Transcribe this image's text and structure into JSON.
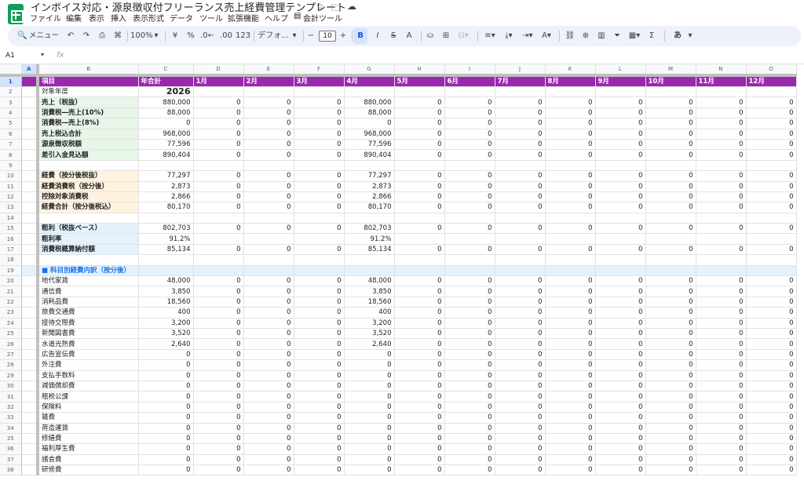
{
  "app": {
    "title": "インボイス対応・源泉徴収付フリーランス売上経費管理テンプレート",
    "title_icons": [
      "star-icon",
      "folder-move-icon",
      "cloud-status-icon"
    ]
  },
  "menu": [
    "ファイル",
    "編集",
    "表示",
    "挿入",
    "表示形式",
    "データ",
    "ツール",
    "拡張機能",
    "ヘルプ",
    "会計ツール"
  ],
  "toolbar": {
    "search_label": "メニュー",
    "zoom": "100%",
    "currency": "¥",
    "percent": "%",
    "dec_decrease": ".0←",
    "dec_increase": ".00",
    "more_formats": "123",
    "font": "デフォ...",
    "font_size": "10",
    "bold": "B",
    "italic": "I",
    "strike": "S",
    "text_color": "A",
    "input_tool": "あ"
  },
  "formula_bar": {
    "cell_ref": "A1",
    "fx": "fx",
    "formula": ""
  },
  "columns": [
    "A",
    "B",
    "C",
    "D",
    "E",
    "F",
    "G",
    "H",
    "I",
    "J",
    "K",
    "L",
    "M",
    "N",
    "O"
  ],
  "header_row": [
    "",
    "項目",
    "年合計",
    "1月",
    "2月",
    "3月",
    "4月",
    "5月",
    "6月",
    "7月",
    "8月",
    "9月",
    "10月",
    "11月",
    "12月"
  ],
  "rows": [
    {
      "n": "2",
      "style": "plain",
      "label": "対象年度",
      "total": "2026",
      "months": [
        "",
        "",
        "",
        "",
        "",
        "",
        "",
        "",
        "",
        "",
        "",
        ""
      ]
    },
    {
      "n": "3",
      "style": "green",
      "label": "売上（税抜）",
      "total": "880,000",
      "months": [
        "0",
        "0",
        "0",
        "880,000",
        "0",
        "0",
        "0",
        "0",
        "0",
        "0",
        "0",
        "0"
      ]
    },
    {
      "n": "4",
      "style": "green",
      "label": "消費税―売上(10%)",
      "total": "88,000",
      "months": [
        "0",
        "0",
        "0",
        "88,000",
        "0",
        "0",
        "0",
        "0",
        "0",
        "0",
        "0",
        "0"
      ]
    },
    {
      "n": "5",
      "style": "green",
      "label": "消費税―売上(8%)",
      "total": "0",
      "months": [
        "0",
        "0",
        "0",
        "0",
        "0",
        "0",
        "0",
        "0",
        "0",
        "0",
        "0",
        "0"
      ]
    },
    {
      "n": "6",
      "style": "green",
      "label": "売上税込合計",
      "total": "968,000",
      "months": [
        "0",
        "0",
        "0",
        "968,000",
        "0",
        "0",
        "0",
        "0",
        "0",
        "0",
        "0",
        "0"
      ]
    },
    {
      "n": "7",
      "style": "green",
      "label": "源泉徴収税額",
      "total": "77,596",
      "months": [
        "0",
        "0",
        "0",
        "77,596",
        "0",
        "0",
        "0",
        "0",
        "0",
        "0",
        "0",
        "0"
      ]
    },
    {
      "n": "8",
      "style": "green",
      "label": "差引入金見込額",
      "total": "890,404",
      "months": [
        "0",
        "0",
        "0",
        "890,404",
        "0",
        "0",
        "0",
        "0",
        "0",
        "0",
        "0",
        "0"
      ]
    },
    {
      "n": "9",
      "style": "empty",
      "label": "",
      "total": "",
      "months": [
        "",
        "",
        "",
        "",
        "",
        "",
        "",
        "",
        "",
        "",
        "",
        ""
      ]
    },
    {
      "n": "10",
      "style": "orange",
      "label": "経費（按分後税抜）",
      "total": "77,297",
      "months": [
        "0",
        "0",
        "0",
        "77,297",
        "0",
        "0",
        "0",
        "0",
        "0",
        "0",
        "0",
        "0"
      ]
    },
    {
      "n": "11",
      "style": "orange",
      "label": "経費消費税（按分後）",
      "total": "2,873",
      "months": [
        "0",
        "0",
        "0",
        "2,873",
        "0",
        "0",
        "0",
        "0",
        "0",
        "0",
        "0",
        "0"
      ]
    },
    {
      "n": "12",
      "style": "orange",
      "label": "控除対象消費税",
      "total": "2,866",
      "months": [
        "0",
        "0",
        "0",
        "2,866",
        "0",
        "0",
        "0",
        "0",
        "0",
        "0",
        "0",
        "0"
      ]
    },
    {
      "n": "13",
      "style": "orange",
      "label": "経費合計（按分後税込）",
      "total": "80,170",
      "months": [
        "0",
        "0",
        "0",
        "80,170",
        "0",
        "0",
        "0",
        "0",
        "0",
        "0",
        "0",
        "0"
      ]
    },
    {
      "n": "14",
      "style": "empty",
      "label": "",
      "total": "",
      "months": [
        "",
        "",
        "",
        "",
        "",
        "",
        "",
        "",
        "",
        "",
        "",
        ""
      ]
    },
    {
      "n": "15",
      "style": "blue",
      "label": "粗利（税抜ベース）",
      "total": "802,703",
      "months": [
        "0",
        "0",
        "0",
        "802,703",
        "0",
        "0",
        "0",
        "0",
        "0",
        "0",
        "0",
        "0"
      ]
    },
    {
      "n": "16",
      "style": "blue",
      "label": "粗利率",
      "total": "91.2%",
      "months": [
        "",
        "",
        "",
        "91.2%",
        "",
        "",
        "",
        "",
        "",
        "",
        "",
        ""
      ]
    },
    {
      "n": "17",
      "style": "blue",
      "label": "消費税概算納付額",
      "total": "85,134",
      "months": [
        "0",
        "0",
        "0",
        "85,134",
        "0",
        "0",
        "0",
        "0",
        "0",
        "0",
        "0",
        "0"
      ]
    },
    {
      "n": "18",
      "style": "empty",
      "label": "",
      "total": "",
      "months": [
        "",
        "",
        "",
        "",
        "",
        "",
        "",
        "",
        "",
        "",
        "",
        ""
      ]
    },
    {
      "n": "19",
      "style": "section",
      "label": "■ 科目別経費内訳（按分後）",
      "total": "",
      "months": [
        "",
        "",
        "",
        "",
        "",
        "",
        "",
        "",
        "",
        "",
        "",
        ""
      ]
    },
    {
      "n": "20",
      "style": "plain",
      "label": "地代家賃",
      "total": "48,000",
      "months": [
        "0",
        "0",
        "0",
        "48,000",
        "0",
        "0",
        "0",
        "0",
        "0",
        "0",
        "0",
        "0"
      ]
    },
    {
      "n": "21",
      "style": "plain",
      "label": "通信費",
      "total": "3,850",
      "months": [
        "0",
        "0",
        "0",
        "3,850",
        "0",
        "0",
        "0",
        "0",
        "0",
        "0",
        "0",
        "0"
      ]
    },
    {
      "n": "22",
      "style": "plain",
      "label": "消耗品費",
      "total": "18,560",
      "months": [
        "0",
        "0",
        "0",
        "18,560",
        "0",
        "0",
        "0",
        "0",
        "0",
        "0",
        "0",
        "0"
      ]
    },
    {
      "n": "23",
      "style": "plain",
      "label": "旅費交通費",
      "total": "400",
      "months": [
        "0",
        "0",
        "0",
        "400",
        "0",
        "0",
        "0",
        "0",
        "0",
        "0",
        "0",
        "0"
      ]
    },
    {
      "n": "24",
      "style": "plain",
      "label": "接待交際費",
      "total": "3,200",
      "months": [
        "0",
        "0",
        "0",
        "3,200",
        "0",
        "0",
        "0",
        "0",
        "0",
        "0",
        "0",
        "0"
      ]
    },
    {
      "n": "25",
      "style": "plain",
      "label": "新聞図書費",
      "total": "3,520",
      "months": [
        "0",
        "0",
        "0",
        "3,520",
        "0",
        "0",
        "0",
        "0",
        "0",
        "0",
        "0",
        "0"
      ]
    },
    {
      "n": "26",
      "style": "plain",
      "label": "水道光熱費",
      "total": "2,640",
      "months": [
        "0",
        "0",
        "0",
        "2,640",
        "0",
        "0",
        "0",
        "0",
        "0",
        "0",
        "0",
        "0"
      ]
    },
    {
      "n": "27",
      "style": "plain",
      "label": "広告宣伝費",
      "total": "0",
      "months": [
        "0",
        "0",
        "0",
        "0",
        "0",
        "0",
        "0",
        "0",
        "0",
        "0",
        "0",
        "0"
      ]
    },
    {
      "n": "28",
      "style": "plain",
      "label": "外注費",
      "total": "0",
      "months": [
        "0",
        "0",
        "0",
        "0",
        "0",
        "0",
        "0",
        "0",
        "0",
        "0",
        "0",
        "0"
      ]
    },
    {
      "n": "29",
      "style": "plain",
      "label": "支払手数料",
      "total": "0",
      "months": [
        "0",
        "0",
        "0",
        "0",
        "0",
        "0",
        "0",
        "0",
        "0",
        "0",
        "0",
        "0"
      ]
    },
    {
      "n": "30",
      "style": "plain",
      "label": "減価償却費",
      "total": "0",
      "months": [
        "0",
        "0",
        "0",
        "0",
        "0",
        "0",
        "0",
        "0",
        "0",
        "0",
        "0",
        "0"
      ]
    },
    {
      "n": "31",
      "style": "plain",
      "label": "租税公課",
      "total": "0",
      "months": [
        "0",
        "0",
        "0",
        "0",
        "0",
        "0",
        "0",
        "0",
        "0",
        "0",
        "0",
        "0"
      ]
    },
    {
      "n": "32",
      "style": "plain",
      "label": "保険料",
      "total": "0",
      "months": [
        "0",
        "0",
        "0",
        "0",
        "0",
        "0",
        "0",
        "0",
        "0",
        "0",
        "0",
        "0"
      ]
    },
    {
      "n": "33",
      "style": "plain",
      "label": "雑費",
      "total": "0",
      "months": [
        "0",
        "0",
        "0",
        "0",
        "0",
        "0",
        "0",
        "0",
        "0",
        "0",
        "0",
        "0"
      ]
    },
    {
      "n": "34",
      "style": "plain",
      "label": "荷造運賃",
      "total": "0",
      "months": [
        "0",
        "0",
        "0",
        "0",
        "0",
        "0",
        "0",
        "0",
        "0",
        "0",
        "0",
        "0"
      ]
    },
    {
      "n": "35",
      "style": "plain",
      "label": "修繕費",
      "total": "0",
      "months": [
        "0",
        "0",
        "0",
        "0",
        "0",
        "0",
        "0",
        "0",
        "0",
        "0",
        "0",
        "0"
      ]
    },
    {
      "n": "36",
      "style": "plain",
      "label": "福利厚生費",
      "total": "0",
      "months": [
        "0",
        "0",
        "0",
        "0",
        "0",
        "0",
        "0",
        "0",
        "0",
        "0",
        "0",
        "0"
      ]
    },
    {
      "n": "37",
      "style": "plain",
      "label": "諸会費",
      "total": "0",
      "months": [
        "0",
        "0",
        "0",
        "0",
        "0",
        "0",
        "0",
        "0",
        "0",
        "0",
        "0",
        "0"
      ]
    },
    {
      "n": "38",
      "style": "plain",
      "label": "研修費",
      "total": "0",
      "months": [
        "0",
        "0",
        "0",
        "0",
        "0",
        "0",
        "0",
        "0",
        "0",
        "0",
        "0",
        "0"
      ]
    }
  ],
  "colors": {
    "header_purple": "#9b27b0",
    "green_fill": "#e8f5e9",
    "orange_fill": "#fff3e0",
    "blue_fill": "#e3f2fd",
    "section_text": "#1a73e8",
    "selection": "#d3e3fd"
  }
}
